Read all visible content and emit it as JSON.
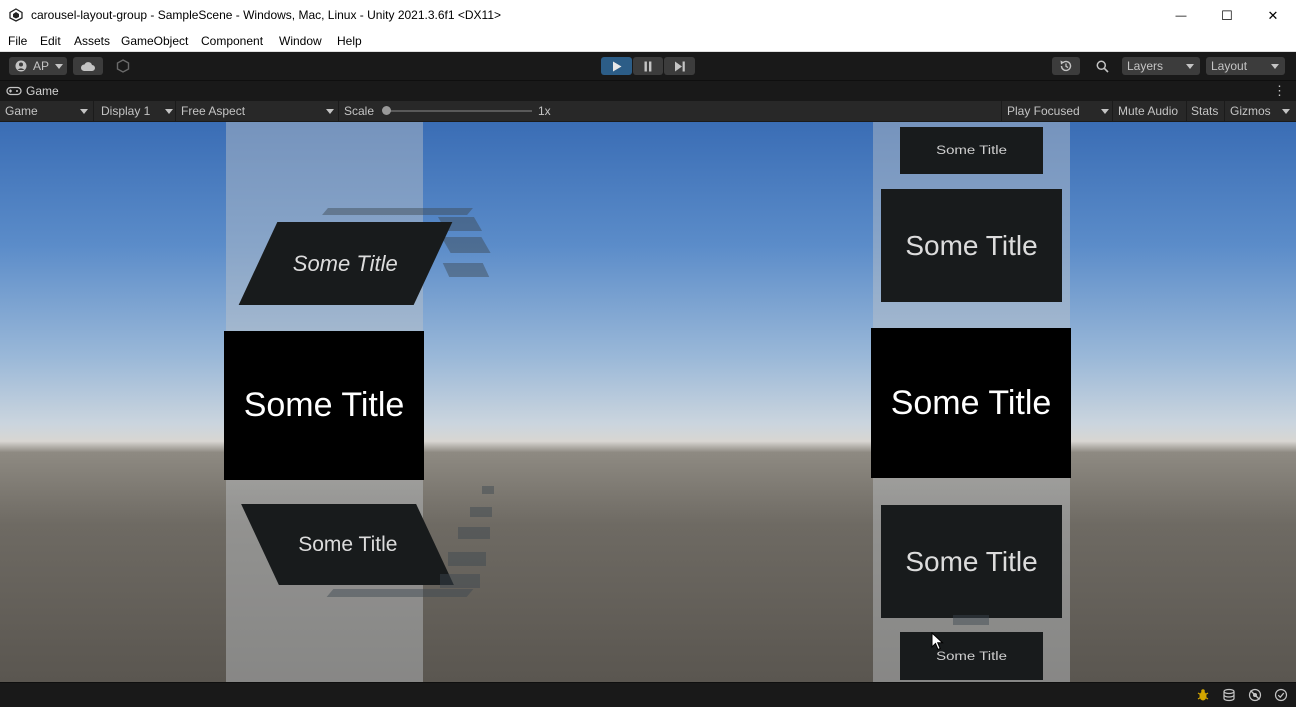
{
  "window": {
    "title": "carousel-layout-group - SampleScene - Windows, Mac, Linux - Unity 2021.3.6f1 <DX11>",
    "minimize_glyph": "—",
    "maximize_glyph": "☐",
    "close_glyph": "✕"
  },
  "menu": [
    "File",
    "Edit",
    "Assets",
    "GameObject",
    "Component",
    "Window",
    "Help"
  ],
  "toolbar": {
    "account_label": "AP",
    "layers_label": "Layers",
    "layout_label": "Layout"
  },
  "tab": {
    "label": "Game",
    "more_glyph": "⋮"
  },
  "game_toolbar": {
    "mode": "Game",
    "display": "Display 1",
    "aspect": "Free Aspect",
    "scale_label": "Scale",
    "scale_value": "1x",
    "play_focused": "Play Focused",
    "mute_audio": "Mute Audio",
    "stats": "Stats",
    "gizmos": "Gizmos"
  },
  "scene": {
    "left_cards": [
      "Some Title",
      "Some Title",
      "Some Title"
    ],
    "right_cards": [
      "Some Title",
      "Some Title",
      "Some Title",
      "Some Title",
      "Some Title"
    ]
  },
  "colors": {
    "play_active": "#2c5d87",
    "editor_dark": "#191919"
  }
}
